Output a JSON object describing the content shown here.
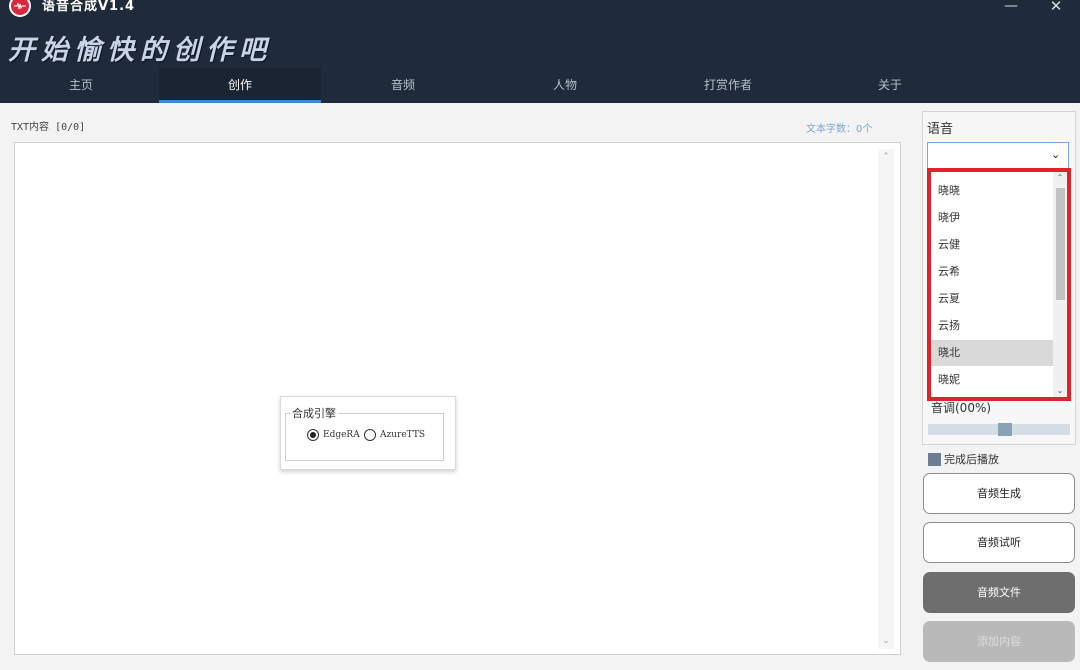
{
  "window": {
    "title": "语音合成V1.4",
    "minimize_glyph": "—",
    "close_glyph": "✕"
  },
  "header": {
    "slogan": "开始愉快的创作吧"
  },
  "nav": {
    "tabs": [
      {
        "label": "主页"
      },
      {
        "label": "创作"
      },
      {
        "label": "音频"
      },
      {
        "label": "人物"
      },
      {
        "label": "打赏作者"
      },
      {
        "label": "关于"
      }
    ],
    "active": "创作"
  },
  "editor": {
    "txt_label": "TXT内容 [0/0]",
    "char_count": "文本字数：0个",
    "value": ""
  },
  "engine": {
    "title": "合成引擎",
    "options": [
      {
        "label": "EdgeRA",
        "selected": true
      },
      {
        "label": "AzureTTS",
        "selected": false
      }
    ]
  },
  "voice": {
    "label": "语音",
    "selected": "",
    "options": [
      "晓晓",
      "晓伊",
      "云健",
      "云希",
      "云夏",
      "云扬",
      "晓北",
      "晓妮"
    ],
    "highlighted": "晓北"
  },
  "pitch": {
    "label": "音调(00%)",
    "value_fraction": 0.54
  },
  "autoplay": {
    "label": "完成后播放",
    "checked": false
  },
  "buttons": {
    "generate": "音频生成",
    "preview": "音频试听",
    "file": "音频文件",
    "add_content": "添加内容"
  },
  "colors": {
    "header_bg": "#1f2a3a",
    "nav_accent": "#3b86d8",
    "dropdown_highlight_border": "#e3212b",
    "char_count_text": "#7ea6d0"
  },
  "icons": {
    "logo": "microphone-logo-icon",
    "select_chevron": "chevron-down-icon"
  }
}
